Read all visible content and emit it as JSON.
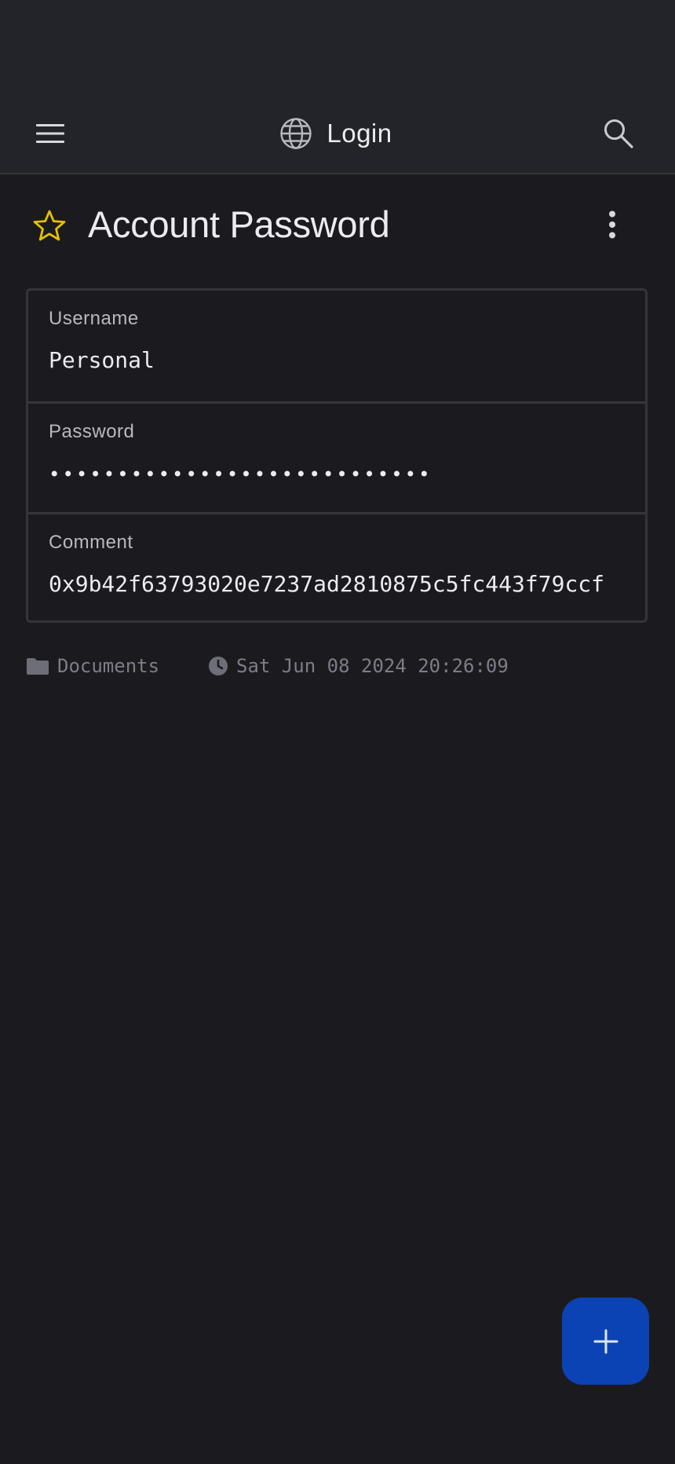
{
  "app_bar": {
    "title": "Login",
    "menu_icon": "hamburger-menu-icon",
    "title_icon": "globe-icon",
    "search_icon": "search-icon"
  },
  "entry": {
    "title": "Account Password",
    "favorite_icon": "star-outline-icon",
    "more_icon": "more-vertical-icon"
  },
  "fields": [
    {
      "label": "Username",
      "value": "Personal"
    },
    {
      "label": "Password",
      "value": "••••••••••••••••••••••••••••"
    },
    {
      "label": "Comment",
      "value": "0x9b42f63793020e7237ad2810875c5fc443f79ccf"
    }
  ],
  "meta": {
    "folder": "Documents",
    "folder_icon": "folder-icon",
    "timestamp": "Sat Jun 08 2024 20:26:09",
    "timestamp_icon": "clock-icon"
  },
  "fab": {
    "icon": "plus-icon"
  },
  "colors": {
    "background": "#1b1b1f",
    "app_bar": "#232429",
    "star": "#e5c100",
    "fab": "#0b43b4",
    "meta_text": "#7c7d87"
  }
}
